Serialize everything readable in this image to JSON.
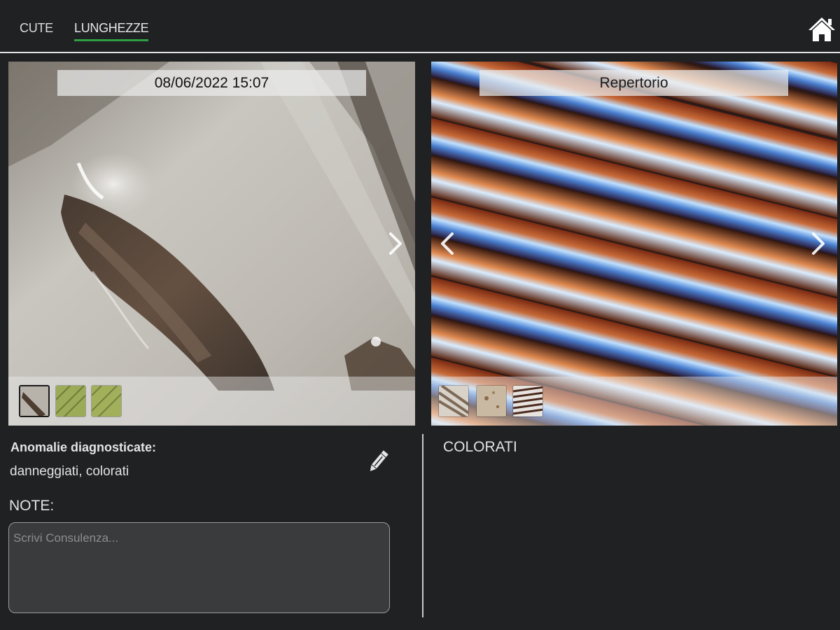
{
  "tabs": [
    {
      "label": "CUTE",
      "active": false
    },
    {
      "label": "LUNGHEZZE",
      "active": true
    }
  ],
  "header": {
    "home_icon": "home-icon",
    "active_tab_color": "#2ea043"
  },
  "left_panel": {
    "caption": "08/06/2022 15:07",
    "nav": {
      "next_icon": "chevron-right-icon"
    },
    "thumbnails": [
      {
        "name": "hair-root",
        "active": true
      },
      {
        "name": "scalp-green-1",
        "active": false
      },
      {
        "name": "scalp-green-2",
        "active": false
      }
    ]
  },
  "right_panel": {
    "caption": "Repertorio",
    "nav": {
      "prev_icon": "chevron-left-icon",
      "next_icon": "chevron-right-icon"
    },
    "thumbnails": [
      {
        "name": "repertorio-1",
        "active": false
      },
      {
        "name": "repertorio-2",
        "active": false
      },
      {
        "name": "repertorio-3",
        "active": false
      }
    ]
  },
  "diagnosis": {
    "title": "Anomalie diagnosticate:",
    "value": "danneggiati, colorati",
    "edit_icon": "pencil-icon"
  },
  "notes": {
    "label": "NOTE:",
    "placeholder": "Scrivi Consulenza...",
    "value": ""
  },
  "right_info": {
    "label": "COLORATI"
  }
}
